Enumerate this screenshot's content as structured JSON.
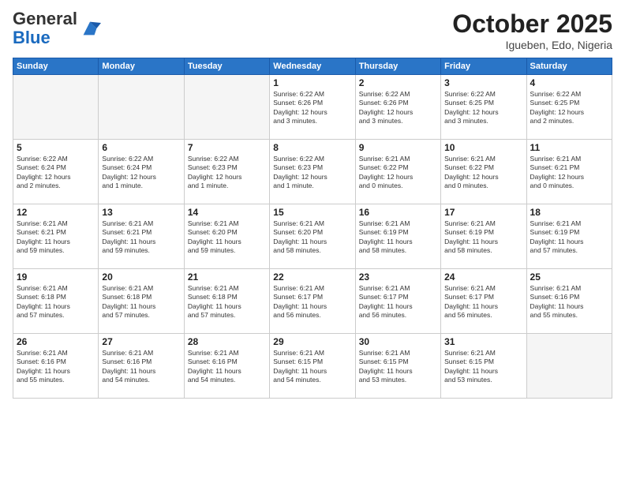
{
  "header": {
    "logo_general": "General",
    "logo_blue": "Blue",
    "month_title": "October 2025",
    "location": "Igueben, Edo, Nigeria"
  },
  "weekdays": [
    "Sunday",
    "Monday",
    "Tuesday",
    "Wednesday",
    "Thursday",
    "Friday",
    "Saturday"
  ],
  "weeks": [
    [
      {
        "day": "",
        "info": ""
      },
      {
        "day": "",
        "info": ""
      },
      {
        "day": "",
        "info": ""
      },
      {
        "day": "1",
        "info": "Sunrise: 6:22 AM\nSunset: 6:26 PM\nDaylight: 12 hours\nand 3 minutes."
      },
      {
        "day": "2",
        "info": "Sunrise: 6:22 AM\nSunset: 6:26 PM\nDaylight: 12 hours\nand 3 minutes."
      },
      {
        "day": "3",
        "info": "Sunrise: 6:22 AM\nSunset: 6:25 PM\nDaylight: 12 hours\nand 3 minutes."
      },
      {
        "day": "4",
        "info": "Sunrise: 6:22 AM\nSunset: 6:25 PM\nDaylight: 12 hours\nand 2 minutes."
      }
    ],
    [
      {
        "day": "5",
        "info": "Sunrise: 6:22 AM\nSunset: 6:24 PM\nDaylight: 12 hours\nand 2 minutes."
      },
      {
        "day": "6",
        "info": "Sunrise: 6:22 AM\nSunset: 6:24 PM\nDaylight: 12 hours\nand 1 minute."
      },
      {
        "day": "7",
        "info": "Sunrise: 6:22 AM\nSunset: 6:23 PM\nDaylight: 12 hours\nand 1 minute."
      },
      {
        "day": "8",
        "info": "Sunrise: 6:22 AM\nSunset: 6:23 PM\nDaylight: 12 hours\nand 1 minute."
      },
      {
        "day": "9",
        "info": "Sunrise: 6:21 AM\nSunset: 6:22 PM\nDaylight: 12 hours\nand 0 minutes."
      },
      {
        "day": "10",
        "info": "Sunrise: 6:21 AM\nSunset: 6:22 PM\nDaylight: 12 hours\nand 0 minutes."
      },
      {
        "day": "11",
        "info": "Sunrise: 6:21 AM\nSunset: 6:21 PM\nDaylight: 12 hours\nand 0 minutes."
      }
    ],
    [
      {
        "day": "12",
        "info": "Sunrise: 6:21 AM\nSunset: 6:21 PM\nDaylight: 11 hours\nand 59 minutes."
      },
      {
        "day": "13",
        "info": "Sunrise: 6:21 AM\nSunset: 6:21 PM\nDaylight: 11 hours\nand 59 minutes."
      },
      {
        "day": "14",
        "info": "Sunrise: 6:21 AM\nSunset: 6:20 PM\nDaylight: 11 hours\nand 59 minutes."
      },
      {
        "day": "15",
        "info": "Sunrise: 6:21 AM\nSunset: 6:20 PM\nDaylight: 11 hours\nand 58 minutes."
      },
      {
        "day": "16",
        "info": "Sunrise: 6:21 AM\nSunset: 6:19 PM\nDaylight: 11 hours\nand 58 minutes."
      },
      {
        "day": "17",
        "info": "Sunrise: 6:21 AM\nSunset: 6:19 PM\nDaylight: 11 hours\nand 58 minutes."
      },
      {
        "day": "18",
        "info": "Sunrise: 6:21 AM\nSunset: 6:19 PM\nDaylight: 11 hours\nand 57 minutes."
      }
    ],
    [
      {
        "day": "19",
        "info": "Sunrise: 6:21 AM\nSunset: 6:18 PM\nDaylight: 11 hours\nand 57 minutes."
      },
      {
        "day": "20",
        "info": "Sunrise: 6:21 AM\nSunset: 6:18 PM\nDaylight: 11 hours\nand 57 minutes."
      },
      {
        "day": "21",
        "info": "Sunrise: 6:21 AM\nSunset: 6:18 PM\nDaylight: 11 hours\nand 57 minutes."
      },
      {
        "day": "22",
        "info": "Sunrise: 6:21 AM\nSunset: 6:17 PM\nDaylight: 11 hours\nand 56 minutes."
      },
      {
        "day": "23",
        "info": "Sunrise: 6:21 AM\nSunset: 6:17 PM\nDaylight: 11 hours\nand 56 minutes."
      },
      {
        "day": "24",
        "info": "Sunrise: 6:21 AM\nSunset: 6:17 PM\nDaylight: 11 hours\nand 56 minutes."
      },
      {
        "day": "25",
        "info": "Sunrise: 6:21 AM\nSunset: 6:16 PM\nDaylight: 11 hours\nand 55 minutes."
      }
    ],
    [
      {
        "day": "26",
        "info": "Sunrise: 6:21 AM\nSunset: 6:16 PM\nDaylight: 11 hours\nand 55 minutes."
      },
      {
        "day": "27",
        "info": "Sunrise: 6:21 AM\nSunset: 6:16 PM\nDaylight: 11 hours\nand 54 minutes."
      },
      {
        "day": "28",
        "info": "Sunrise: 6:21 AM\nSunset: 6:16 PM\nDaylight: 11 hours\nand 54 minutes."
      },
      {
        "day": "29",
        "info": "Sunrise: 6:21 AM\nSunset: 6:15 PM\nDaylight: 11 hours\nand 54 minutes."
      },
      {
        "day": "30",
        "info": "Sunrise: 6:21 AM\nSunset: 6:15 PM\nDaylight: 11 hours\nand 53 minutes."
      },
      {
        "day": "31",
        "info": "Sunrise: 6:21 AM\nSunset: 6:15 PM\nDaylight: 11 hours\nand 53 minutes."
      },
      {
        "day": "",
        "info": ""
      }
    ]
  ]
}
